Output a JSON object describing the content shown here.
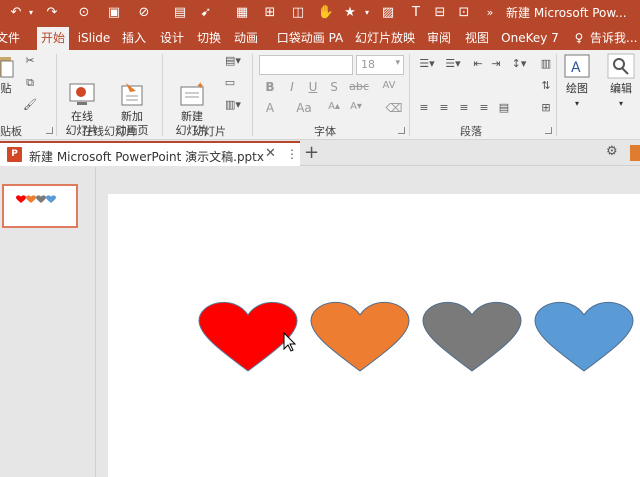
{
  "window": {
    "title": "新建 Microsoft Pow..."
  },
  "tabs": [
    "文件",
    "开始",
    "iSlide",
    "插入",
    "设计",
    "切换",
    "动画",
    "口袋动画 PA",
    "幻灯片放映",
    "审阅",
    "视图",
    "OneKey 7",
    "告诉我..."
  ],
  "active_tab": "开始",
  "ribbon": {
    "clipboard": {
      "label": "贴板",
      "paste_label": "贴"
    },
    "online_slides": {
      "label": "在线幻灯片",
      "btn1": "在线\n幻灯片",
      "btn2": "新加\n动画页"
    },
    "slides": {
      "label": "幻灯片",
      "new_slide": "新建\n幻灯片"
    },
    "font": {
      "label": "字体",
      "size": "18",
      "bold": "B",
      "italic": "I",
      "underline": "U",
      "strike": "S",
      "spacing": "abc",
      "aa": "Aa"
    },
    "paragraph": {
      "label": "段落"
    },
    "drawing": {
      "label": "绘图"
    },
    "editing": {
      "label": "编辑"
    }
  },
  "document_tab": {
    "name": "新建 Microsoft PowerPoint 演示文稿.pptx",
    "icon_text": "P"
  },
  "slide": {
    "hearts": [
      {
        "name": "red-heart",
        "color": "#ff0000",
        "stroke": "#5b7a9c"
      },
      {
        "name": "orange-heart",
        "color": "#ed7d31",
        "stroke": "#4f6d8f"
      },
      {
        "name": "gray-heart",
        "color": "#7a7a7a",
        "stroke": "#4f6d8f"
      },
      {
        "name": "blue-heart",
        "color": "#5b9bd5",
        "stroke": "#4f6d8f"
      }
    ]
  },
  "thumbnail": {
    "number": "1"
  },
  "colors": {
    "accent": "#b7472a",
    "ribbon_bg": "#f1f1f1"
  }
}
